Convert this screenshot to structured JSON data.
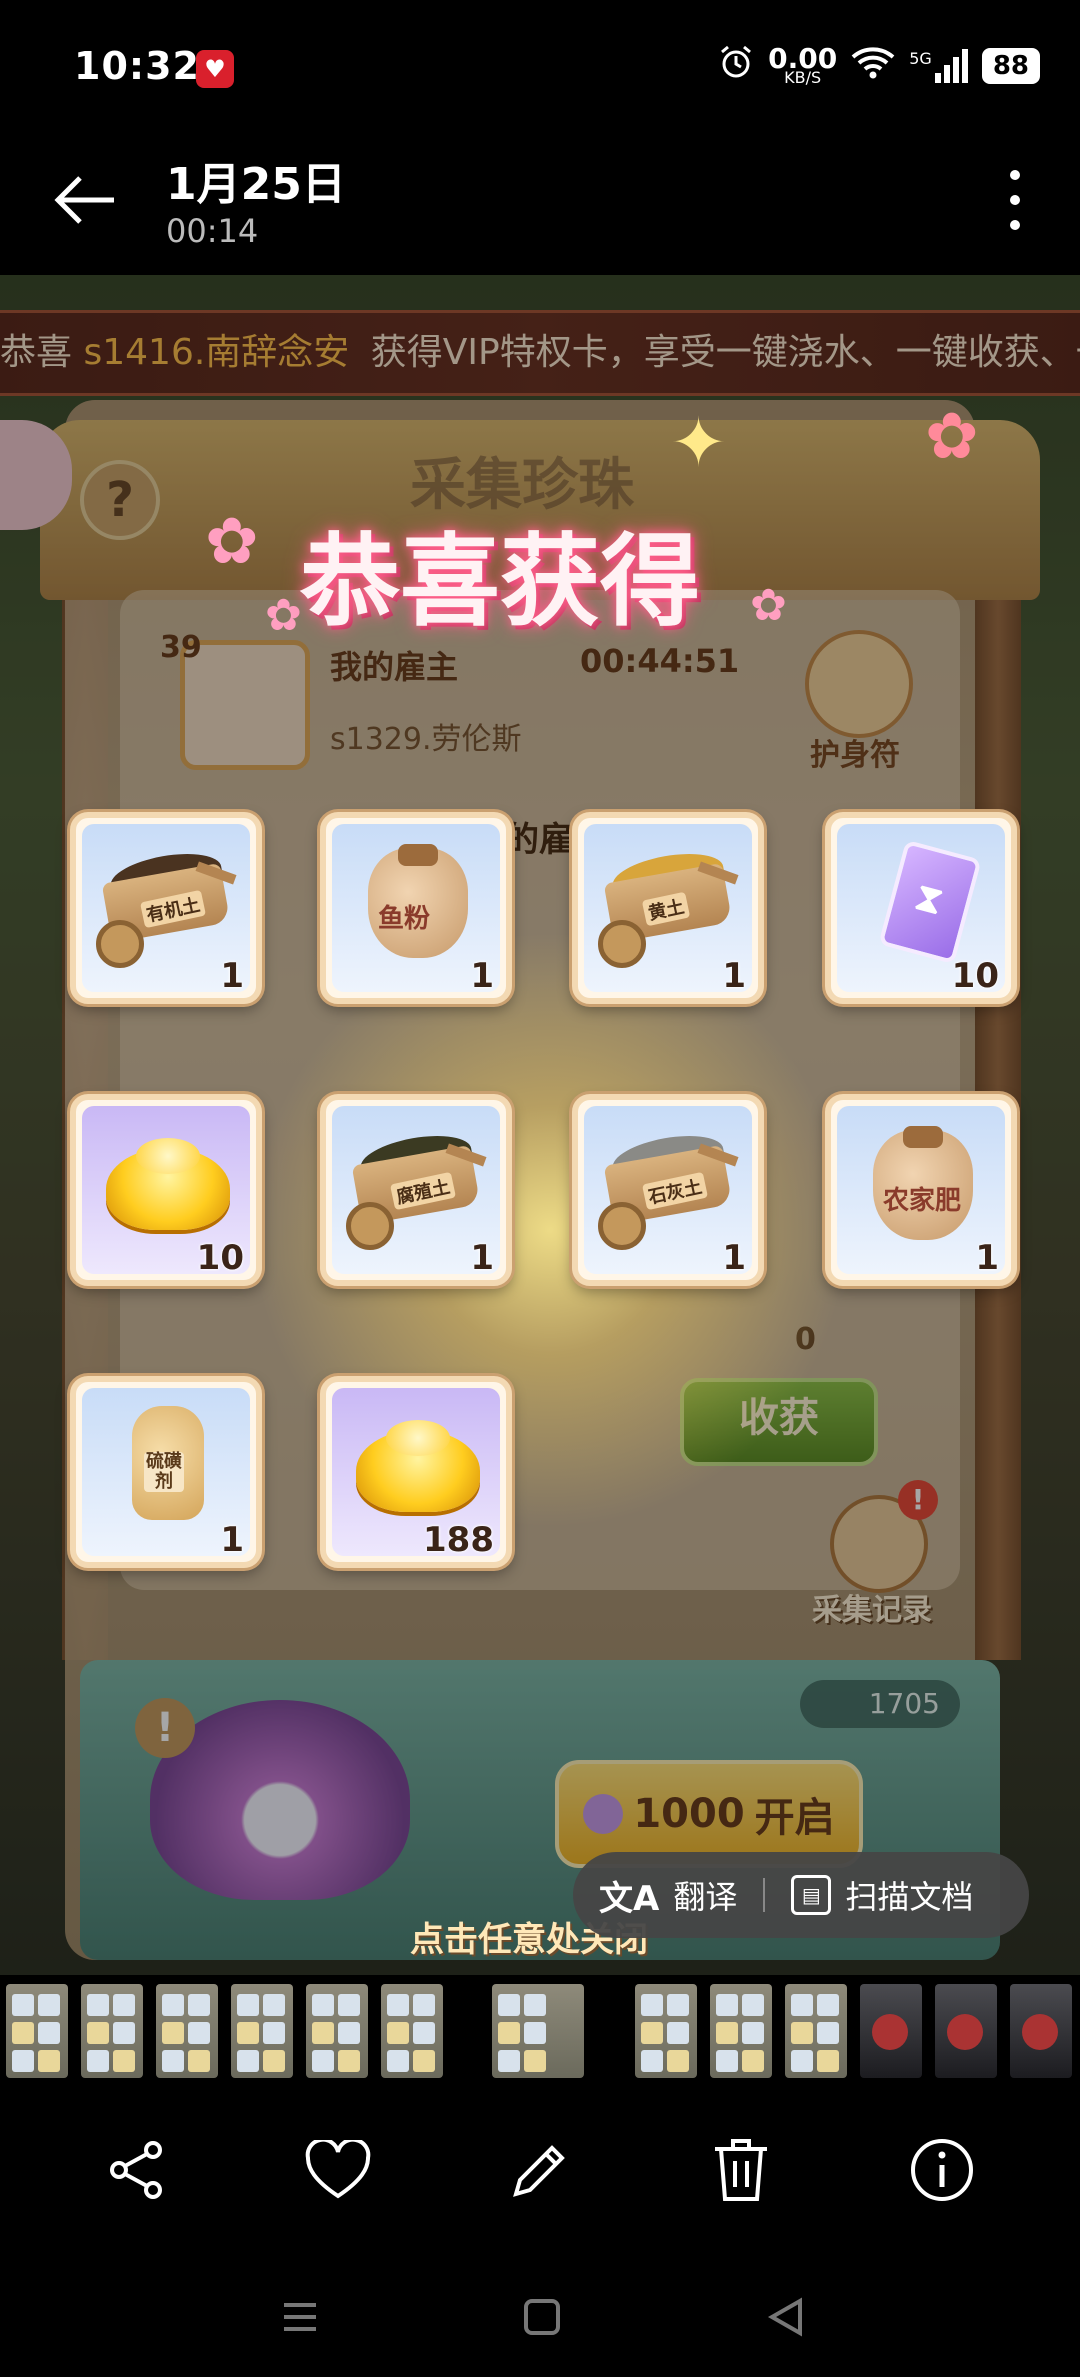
{
  "status_bar": {
    "time": "10:32",
    "net_speed": "0.00",
    "net_unit": "KB/S",
    "network": "5G",
    "battery": "88",
    "icons": [
      "notification-app-icon",
      "alarm-icon",
      "wifi-icon",
      "signal-icon",
      "battery-icon"
    ]
  },
  "header": {
    "date": "1月25日",
    "time": "00:14",
    "back_icon": "arrow-left-icon",
    "menu_icon": "more-vertical-icon"
  },
  "game": {
    "ticker_prefix": "恭喜",
    "ticker_user": "s1416.南辞念安",
    "ticker_text": "获得VIP特权卡，享受一键浇水、一键收获、一",
    "bg_title": "采集珍珠",
    "help": "?",
    "congrats_title": "恭喜获得",
    "employer_level": "39",
    "employer_label": "我的雇主",
    "employer_timer": "00:44:51",
    "employer_name": "s1329.劳伦斯",
    "amulet_label": "护身符",
    "partial_label": "的雇",
    "items": [
      {
        "name": "有机土",
        "count": "1",
        "kind": "cart",
        "load": "#4a3320"
      },
      {
        "name": "鱼粉",
        "count": "1",
        "kind": "bag",
        "bg": "blue"
      },
      {
        "name": "黄土",
        "count": "1",
        "kind": "cart",
        "load": "#d8a53b"
      },
      {
        "name": "",
        "count": "10",
        "kind": "card"
      },
      {
        "name": "",
        "count": "10",
        "kind": "gold"
      },
      {
        "name": "腐殖土",
        "count": "1",
        "kind": "cart",
        "load": "#3b3a22"
      },
      {
        "name": "石灰土",
        "count": "1",
        "kind": "cart",
        "load": "#8a8a86"
      },
      {
        "name": "农家肥",
        "count": "1",
        "kind": "bag",
        "bg": "blue"
      },
      {
        "name": "硫磺剂",
        "count": "1",
        "kind": "bottle"
      },
      {
        "name": "",
        "count": "188",
        "kind": "gold"
      }
    ],
    "pearl_count": "0",
    "harvest_label": "收获",
    "records_badge": "!",
    "records_label": "采集记录",
    "warn": "!",
    "pearls_total": "1705",
    "open_cost": "1000",
    "open_label": "开启",
    "tap_close": "点击任意处关闭"
  },
  "tool_pill": {
    "translate_label": "翻译",
    "scan_label": "扫描文档"
  },
  "thumbnails": {
    "count": 14
  },
  "actions": [
    {
      "name": "share-icon"
    },
    {
      "name": "heart-icon"
    },
    {
      "name": "edit-icon"
    },
    {
      "name": "delete-icon"
    },
    {
      "name": "info-icon"
    }
  ],
  "nav": [
    "menu-nav-icon",
    "home-nav-icon",
    "back-nav-icon"
  ]
}
